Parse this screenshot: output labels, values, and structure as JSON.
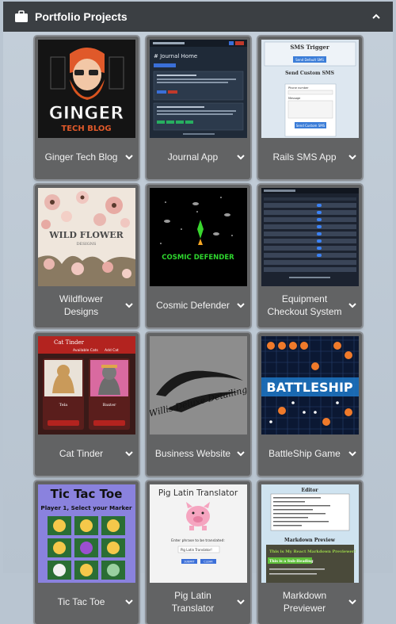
{
  "header": {
    "title": "Portfolio Projects",
    "icon": "briefcase-icon",
    "toggle_icon": "chevron-up-icon"
  },
  "projects": [
    {
      "label": "Ginger Tech Blog",
      "logo_top": "GINGER",
      "logo_bottom": "TECH BLOG"
    },
    {
      "label": "Journal App",
      "heading": "# Journal Home"
    },
    {
      "label": "Rails SMS App",
      "trigger_title": "SMS Trigger",
      "trigger_button": "Send Default SMS",
      "custom_title": "Send Custom SMS",
      "phone_label": "Phone number",
      "message_label": "Message",
      "custom_button": "Send Custom SMS"
    },
    {
      "label": "Wildflower Designs",
      "logo_top": "WILD FLOWER",
      "logo_bottom": "DESIGNS"
    },
    {
      "label": "Cosmic Defender",
      "logo": "COSMIC DEFENDER"
    },
    {
      "label": "Equipment Checkout System"
    },
    {
      "label": "Cat Tinder",
      "app_title": "Cat Tinder",
      "nav_available": "Available Cats",
      "nav_add": "Add Cat",
      "cat1": "Tela",
      "cat2": "Baxter"
    },
    {
      "label": "Business Website",
      "logo": "Willis Deluxe Detailing"
    },
    {
      "label": "BattleShip Game",
      "logo": "BATTLESHIP"
    },
    {
      "label": "Tic Tac Toe",
      "title": "Tic Tac Toe",
      "subtitle": "Player 1, Select your Marker"
    },
    {
      "label": "Pig Latin Translator",
      "title": "Pig Latin Translator",
      "prompt": "Enter phrase to be translated:",
      "input_value": "Pig Latin Translator!",
      "submit": "SUBMIT",
      "clear": "CLEAR"
    },
    {
      "label": "Markdown Previewer",
      "editor_title": "Editor",
      "preview_title": "Markdown Preview",
      "preview_heading": "This is My React Markdown Previewer!",
      "preview_sub": "This is a Sub-Heading"
    }
  ]
}
